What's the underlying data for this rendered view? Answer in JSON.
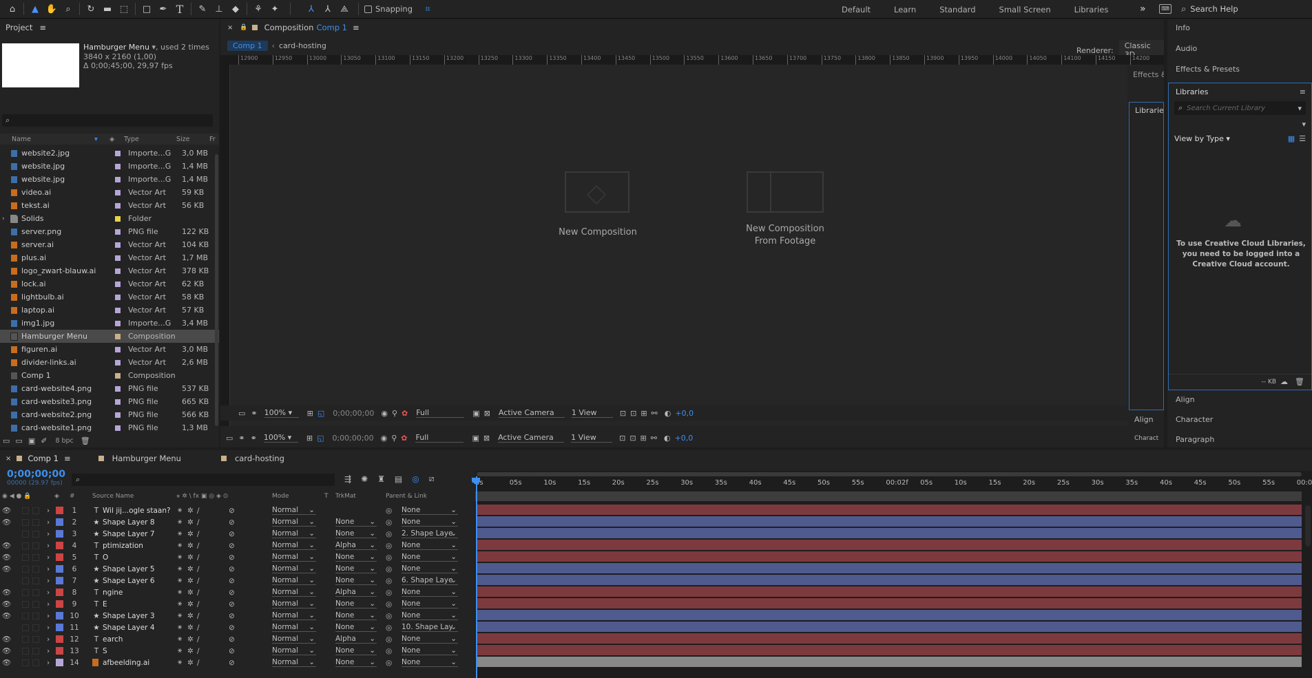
{
  "toolbar": {
    "snapping_label": "Snapping",
    "workspaces": [
      "Default",
      "Learn",
      "Standard",
      "Small Screen",
      "Libraries"
    ],
    "more": "»",
    "search_placeholder": "Search Help"
  },
  "project": {
    "title": "Project",
    "item_name": "Hamburger Menu",
    "item_used": ", used 2 times",
    "item_dims": "3840 x 2160 (1,00)",
    "item_duration": "Δ 0;00;45;00, 29,97 fps",
    "columns": {
      "name": "Name",
      "type": "Type",
      "size": "Size",
      "fr": "Fr"
    },
    "bpc": "8 bpc",
    "items": [
      {
        "name": "website2.jpg",
        "type": "Importe...G",
        "size": "3,0 MB",
        "color": "#b6a6d8",
        "icon": "jpg"
      },
      {
        "name": "website.jpg",
        "type": "Importe...G",
        "size": "1,4 MB",
        "color": "#b6a6d8",
        "icon": "jpg"
      },
      {
        "name": "website.jpg",
        "type": "Importe...G",
        "size": "1,4 MB",
        "color": "#b6a6d8",
        "icon": "jpg"
      },
      {
        "name": "video.ai",
        "type": "Vector Art",
        "size": "59 KB",
        "color": "#b6a6d8",
        "icon": "ai"
      },
      {
        "name": "tekst.ai",
        "type": "Vector Art",
        "size": "56 KB",
        "color": "#b6a6d8",
        "icon": "ai"
      },
      {
        "name": "Solids",
        "type": "Folder",
        "size": "",
        "color": "#e8d34b",
        "icon": "folder"
      },
      {
        "name": "server.png",
        "type": "PNG file",
        "size": "122 KB",
        "color": "#b6a6d8",
        "icon": "png"
      },
      {
        "name": "server.ai",
        "type": "Vector Art",
        "size": "104 KB",
        "color": "#b6a6d8",
        "icon": "ai"
      },
      {
        "name": "plus.ai",
        "type": "Vector Art",
        "size": "1,7 MB",
        "color": "#b6a6d8",
        "icon": "ai"
      },
      {
        "name": "logo_zwart-blauw.ai",
        "type": "Vector Art",
        "size": "378 KB",
        "color": "#b6a6d8",
        "icon": "ai"
      },
      {
        "name": "lock.ai",
        "type": "Vector Art",
        "size": "62 KB",
        "color": "#b6a6d8",
        "icon": "ai"
      },
      {
        "name": "lightbulb.ai",
        "type": "Vector Art",
        "size": "58 KB",
        "color": "#b6a6d8",
        "icon": "ai"
      },
      {
        "name": "laptop.ai",
        "type": "Vector Art",
        "size": "57 KB",
        "color": "#b6a6d8",
        "icon": "ai"
      },
      {
        "name": "img1.jpg",
        "type": "Importe...G",
        "size": "3,4 MB",
        "color": "#b6a6d8",
        "icon": "jpg"
      },
      {
        "name": "Hamburger Menu",
        "type": "Composition",
        "size": "",
        "color": "#c9b08a",
        "icon": "comp",
        "selected": true
      },
      {
        "name": "figuren.ai",
        "type": "Vector Art",
        "size": "3,0 MB",
        "color": "#b6a6d8",
        "icon": "ai"
      },
      {
        "name": "divider-links.ai",
        "type": "Vector Art",
        "size": "2,6 MB",
        "color": "#b6a6d8",
        "icon": "ai"
      },
      {
        "name": "Comp 1",
        "type": "Composition",
        "size": "",
        "color": "#c9b08a",
        "icon": "comp"
      },
      {
        "name": "card-website4.png",
        "type": "PNG file",
        "size": "537 KB",
        "color": "#b6a6d8",
        "icon": "png"
      },
      {
        "name": "card-website3.png",
        "type": "PNG file",
        "size": "665 KB",
        "color": "#b6a6d8",
        "icon": "png"
      },
      {
        "name": "card-website2.png",
        "type": "PNG file",
        "size": "566 KB",
        "color": "#b6a6d8",
        "icon": "png"
      },
      {
        "name": "card-website1.png",
        "type": "PNG file",
        "size": "1,3 MB",
        "color": "#b6a6d8",
        "icon": "png"
      }
    ]
  },
  "composition": {
    "title_prefix": "Composition",
    "title_comp": "Comp 1",
    "tabs": [
      "Comp 1",
      "card-hosting"
    ],
    "renderer_label": "Renderer:",
    "renderer_value": "Classic 3D",
    "ruler_ticks": [
      "12900",
      "12950",
      "13000",
      "13050",
      "13100",
      "13150",
      "13200",
      "13250",
      "13300",
      "13350",
      "13400",
      "13450",
      "13500",
      "13550",
      "13600",
      "13650",
      "13700",
      "13750",
      "13800",
      "13850",
      "13900",
      "13950",
      "14000",
      "14050",
      "14100",
      "14150",
      "14200"
    ],
    "new_comp": "New Composition",
    "new_comp_footage_1": "New Composition",
    "new_comp_footage_2": "From Footage",
    "zoom": "100%",
    "timecode": "0;00;00;00",
    "resolution": "Full",
    "camera": "Active Camera",
    "view": "1 View",
    "exposure": "+0,0"
  },
  "mid_panel": {
    "effects": "Effects &",
    "libraries": "Librarie",
    "align": "Align",
    "character": "Charact"
  },
  "right_panel": {
    "info": "Info",
    "audio": "Audio",
    "effects_presets": "Effects & Presets",
    "libraries_title": "Libraries",
    "search_placeholder": "Search Current Library",
    "view_by": "View by Type",
    "message": "To use Creative Cloud Libraries, you need to be logged into a Creative Cloud account.",
    "kb": "-- KB",
    "align": "Align",
    "character": "Character",
    "paragraph": "Paragraph"
  },
  "timeline": {
    "tabs": [
      "Comp 1",
      "Hamburger Menu",
      "card-hosting"
    ],
    "timecode": "0;00;00;00",
    "fps": "00000 (29.97 fps)",
    "col_hash": "#",
    "col_source": "Source Name",
    "col_mode": "Mode",
    "col_t": "T",
    "col_trkmat": "TrkMat",
    "col_parent": "Parent & Link",
    "ruler": [
      "0s",
      "05s",
      "10s",
      "15s",
      "20s",
      "25s",
      "30s",
      "35s",
      "40s",
      "45s",
      "50s",
      "55s",
      "00:02f",
      "05s",
      "10s",
      "15s",
      "20s",
      "25s",
      "30s",
      "35s",
      "40s",
      "45s",
      "50s",
      "55s",
      "00:0"
    ],
    "layers": [
      {
        "num": "1",
        "type": "T",
        "name": "Wil jij...ogle staan?",
        "label": "#c44",
        "mode": "Normal",
        "trkmat": "",
        "parent": "None",
        "eye": true,
        "bar": "#7d3a3e"
      },
      {
        "num": "2",
        "type": "★",
        "name": "Shape Layer 8",
        "label": "#5a78d6",
        "mode": "Normal",
        "trkmat": "None",
        "parent": "None",
        "eye": true,
        "bar": "#4f5a8e"
      },
      {
        "num": "3",
        "type": "★",
        "name": "Shape Layer 7",
        "label": "#5a78d6",
        "mode": "Normal",
        "trkmat": "None",
        "parent": "2. Shape Laye",
        "eye": false,
        "bar": "#4f5a8e"
      },
      {
        "num": "4",
        "type": "T",
        "name": "ptimization",
        "label": "#c44",
        "mode": "Normal",
        "trkmat": "Alpha",
        "parent": "None",
        "eye": true,
        "bar": "#7d3a3e"
      },
      {
        "num": "5",
        "type": "T",
        "name": "O",
        "label": "#c44",
        "mode": "Normal",
        "trkmat": "None",
        "parent": "None",
        "eye": true,
        "bar": "#7d3a3e"
      },
      {
        "num": "6",
        "type": "★",
        "name": "Shape Layer 5",
        "label": "#5a78d6",
        "mode": "Normal",
        "trkmat": "None",
        "parent": "None",
        "eye": true,
        "bar": "#4f5a8e"
      },
      {
        "num": "7",
        "type": "★",
        "name": "Shape Layer 6",
        "label": "#5a78d6",
        "mode": "Normal",
        "trkmat": "None",
        "parent": "6. Shape Laye",
        "eye": false,
        "bar": "#4f5a8e"
      },
      {
        "num": "8",
        "type": "T",
        "name": "ngine",
        "label": "#c44",
        "mode": "Normal",
        "trkmat": "Alpha",
        "parent": "None",
        "eye": true,
        "bar": "#7d3a3e"
      },
      {
        "num": "9",
        "type": "T",
        "name": "E",
        "label": "#c44",
        "mode": "Normal",
        "trkmat": "None",
        "parent": "None",
        "eye": true,
        "bar": "#7d3a3e"
      },
      {
        "num": "10",
        "type": "★",
        "name": "Shape Layer 3",
        "label": "#5a78d6",
        "mode": "Normal",
        "trkmat": "None",
        "parent": "None",
        "eye": true,
        "bar": "#4f5a8e"
      },
      {
        "num": "11",
        "type": "★",
        "name": "Shape Layer 4",
        "label": "#5a78d6",
        "mode": "Normal",
        "trkmat": "None",
        "parent": "10. Shape Lay",
        "eye": false,
        "bar": "#4f5a8e"
      },
      {
        "num": "12",
        "type": "T",
        "name": "earch",
        "label": "#c44",
        "mode": "Normal",
        "trkmat": "Alpha",
        "parent": "None",
        "eye": true,
        "bar": "#7d3a3e"
      },
      {
        "num": "13",
        "type": "T",
        "name": "S",
        "label": "#c44",
        "mode": "Normal",
        "trkmat": "None",
        "parent": "None",
        "eye": true,
        "bar": "#7d3a3e"
      },
      {
        "num": "14",
        "type": "ai",
        "name": "afbeelding.ai",
        "label": "#b6a6d8",
        "mode": "Normal",
        "trkmat": "None",
        "parent": "None",
        "eye": true,
        "bar": "#888888"
      }
    ]
  }
}
